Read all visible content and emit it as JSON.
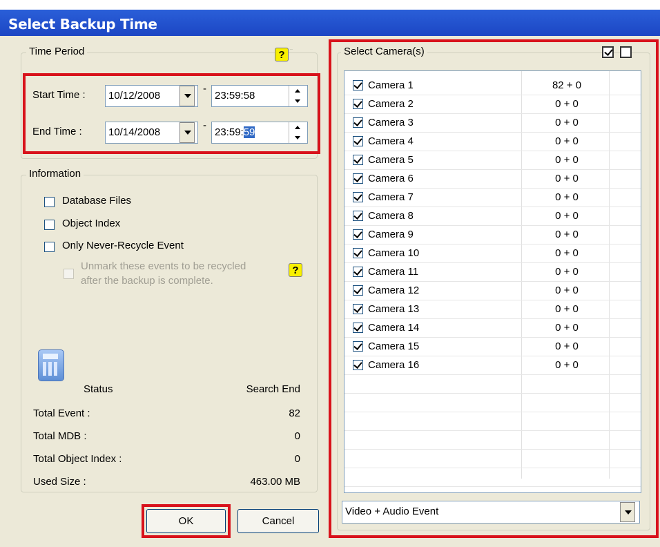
{
  "window": {
    "title": "Select Backup Time"
  },
  "time_period": {
    "legend": "Time Period",
    "start_label": "Start Time :",
    "start_date": "10/12/2008",
    "start_time": "23:59:58",
    "end_label": "End Time :",
    "end_date": "10/14/2008",
    "end_time_prefix": "23:59:",
    "end_time_selected": "59",
    "dash": "-"
  },
  "information": {
    "legend": "Information",
    "options": [
      {
        "label": "Database Files",
        "checked": false
      },
      {
        "label": "Object Index",
        "checked": false
      },
      {
        "label": "Only Never-Recycle Event",
        "checked": false
      }
    ],
    "sub_option_line1": "Unmark these events to be recycled",
    "sub_option_line2": "after the backup is complete."
  },
  "status": {
    "status_label": "Status",
    "status_value": "Search End",
    "rows": [
      {
        "label": "Total Event :",
        "value": "82"
      },
      {
        "label": "Total MDB :",
        "value": "0"
      },
      {
        "label": "Total Object Index :",
        "value": "0"
      },
      {
        "label": "Used Size :",
        "value": "463.00 MB"
      }
    ]
  },
  "buttons": {
    "ok": "OK",
    "cancel": "Cancel"
  },
  "cameras": {
    "legend": "Select Camera(s)",
    "items": [
      {
        "name": "Camera 1",
        "count": "82 + 0",
        "checked": true
      },
      {
        "name": "Camera 2",
        "count": "0 + 0",
        "checked": true
      },
      {
        "name": "Camera 3",
        "count": "0 + 0",
        "checked": true
      },
      {
        "name": "Camera 4",
        "count": "0 + 0",
        "checked": true
      },
      {
        "name": "Camera 5",
        "count": "0 + 0",
        "checked": true
      },
      {
        "name": "Camera 6",
        "count": "0 + 0",
        "checked": true
      },
      {
        "name": "Camera 7",
        "count": "0 + 0",
        "checked": true
      },
      {
        "name": "Camera 8",
        "count": "0 + 0",
        "checked": true
      },
      {
        "name": "Camera 9",
        "count": "0 + 0",
        "checked": true
      },
      {
        "name": "Camera 10",
        "count": "0 + 0",
        "checked": true
      },
      {
        "name": "Camera 11",
        "count": "0 + 0",
        "checked": true
      },
      {
        "name": "Camera 12",
        "count": "0 + 0",
        "checked": true
      },
      {
        "name": "Camera 13",
        "count": "0 + 0",
        "checked": true
      },
      {
        "name": "Camera 14",
        "count": "0 + 0",
        "checked": true
      },
      {
        "name": "Camera 15",
        "count": "0 + 0",
        "checked": true
      },
      {
        "name": "Camera 16",
        "count": "0 + 0",
        "checked": true
      }
    ],
    "event_type": "Video + Audio Event"
  },
  "colors": {
    "title_bar": "#1c46c4",
    "highlight": "#d8121b",
    "dialog_bg": "#ece9d8",
    "help_icon": "#f8f000"
  },
  "icons": {
    "help": "help-icon",
    "select_all": "check-all-icon",
    "select_none": "uncheck-all-icon",
    "status": "calculator-icon"
  }
}
